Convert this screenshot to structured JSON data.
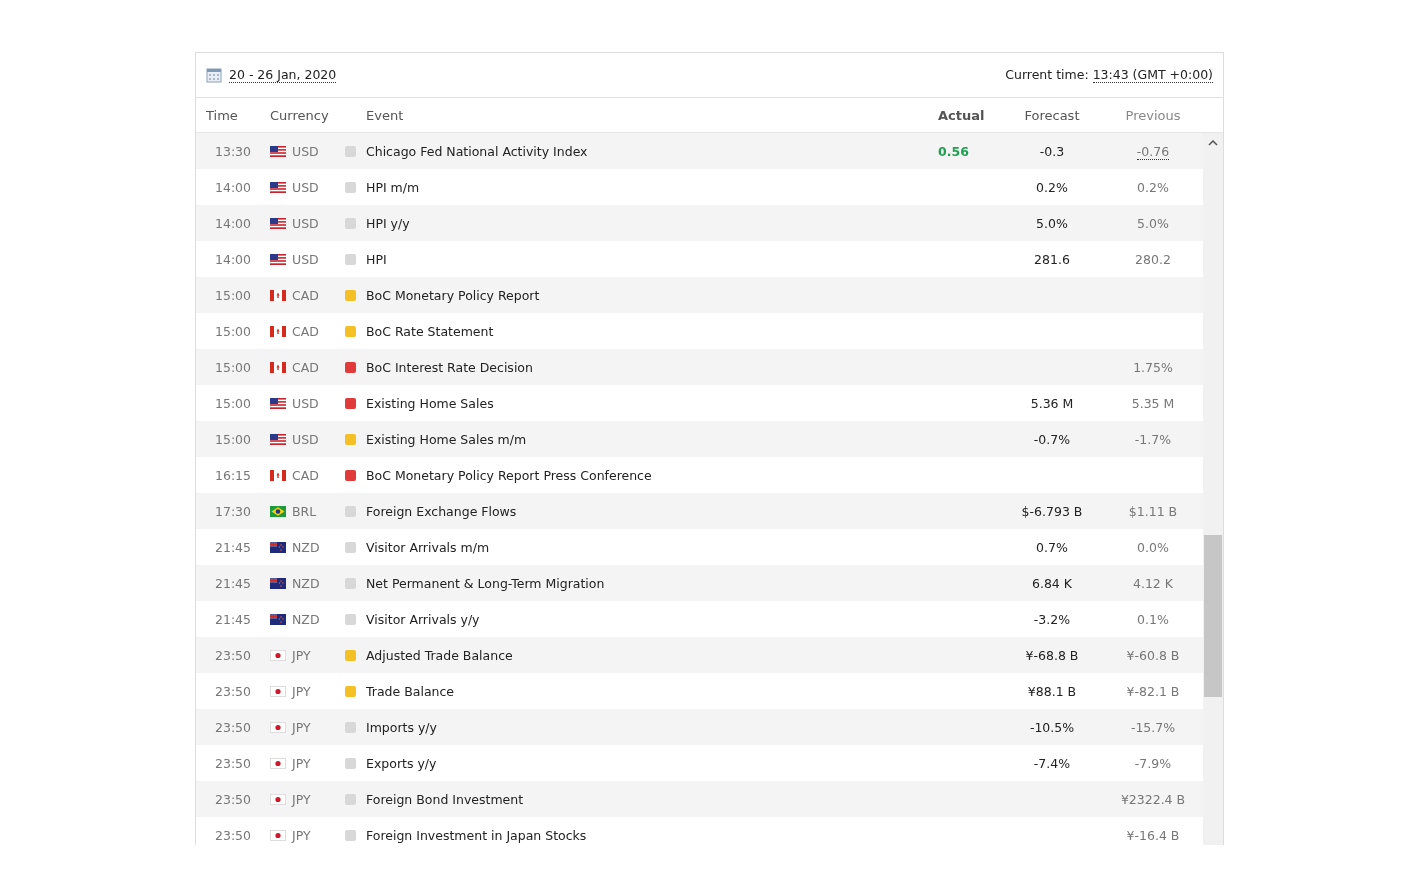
{
  "header": {
    "week": "20 - 26 Jan, 2020",
    "current_time_label": "Current time:",
    "current_time": "13:43 (GMT +0:00)"
  },
  "columns": [
    "Time",
    "Currency",
    "Event",
    "Actual",
    "Forecast",
    "Previous"
  ],
  "rows": [
    {
      "time": "13:30",
      "flag": {
        "kind": "us"
      },
      "currency": "USD",
      "color": "#d8d8d8",
      "event": "Chicago Fed National Activity Index",
      "actual": {
        "text": "0.56",
        "color": "#21a051"
      },
      "forecast": "-0.3",
      "previous": "-0.76",
      "previous_revised": true
    },
    {
      "time": "14:00",
      "flag": {
        "kind": "us"
      },
      "currency": "USD",
      "color": "#d8d8d8",
      "event": "HPI m/m",
      "forecast": "0.2%",
      "previous": "0.2%",
      "previous_revised": false
    },
    {
      "time": "14:00",
      "flag": {
        "kind": "us"
      },
      "currency": "USD",
      "color": "#d8d8d8",
      "event": "HPI y/y",
      "forecast": "5.0%",
      "previous": "5.0%",
      "previous_revised": false
    },
    {
      "time": "14:00",
      "flag": {
        "kind": "us"
      },
      "currency": "USD",
      "color": "#d8d8d8",
      "event": "HPI",
      "forecast": "281.6",
      "previous": "280.2",
      "previous_revised": false
    },
    {
      "time": "15:00",
      "flag": {
        "kind": "ca"
      },
      "currency": "CAD",
      "color": "#f5c026",
      "event": "BoC Monetary Policy Report"
    },
    {
      "time": "15:00",
      "flag": {
        "kind": "ca"
      },
      "currency": "CAD",
      "color": "#f5c026",
      "event": "BoC Rate Statement"
    },
    {
      "time": "15:00",
      "flag": {
        "kind": "ca"
      },
      "currency": "CAD",
      "color": "#e03a3a",
      "event": "BoC Interest Rate Decision",
      "previous": "1.75%",
      "previous_revised": false
    },
    {
      "time": "15:00",
      "flag": {
        "kind": "us"
      },
      "currency": "USD",
      "color": "#e03a3a",
      "event": "Existing Home Sales",
      "forecast": "5.36 M",
      "previous": "5.35 M",
      "previous_revised": false
    },
    {
      "time": "15:00",
      "flag": {
        "kind": "us"
      },
      "currency": "USD",
      "color": "#f5c026",
      "event": "Existing Home Sales m/m",
      "forecast": "-0.7%",
      "previous": "-1.7%",
      "previous_revised": false
    },
    {
      "time": "16:15",
      "flag": {
        "kind": "ca"
      },
      "currency": "CAD",
      "color": "#e03a3a",
      "event": "BoC Monetary Policy Report Press Conference"
    },
    {
      "time": "17:30",
      "flag": {
        "kind": "br"
      },
      "currency": "BRL",
      "color": "#d8d8d8",
      "event": "Foreign Exchange Flows",
      "forecast": "$-6.793 B",
      "previous": "$1.11 B",
      "previous_revised": false
    },
    {
      "time": "21:45",
      "flag": {
        "kind": "nz"
      },
      "currency": "NZD",
      "color": "#d8d8d8",
      "event": "Visitor Arrivals m/m",
      "forecast": "0.7%",
      "previous": "0.0%",
      "previous_revised": false
    },
    {
      "time": "21:45",
      "flag": {
        "kind": "nz"
      },
      "currency": "NZD",
      "color": "#d8d8d8",
      "event": "Net Permanent & Long-Term Migration",
      "forecast": "6.84 K",
      "previous": "4.12 K",
      "previous_revised": false
    },
    {
      "time": "21:45",
      "flag": {
        "kind": "nz"
      },
      "currency": "NZD",
      "color": "#d8d8d8",
      "event": "Visitor Arrivals y/y",
      "forecast": "-3.2%",
      "previous": "0.1%",
      "previous_revised": false
    },
    {
      "time": "23:50",
      "flag": {
        "kind": "jp"
      },
      "currency": "JPY",
      "color": "#f5c026",
      "event": "Adjusted Trade Balance",
      "forecast": "¥-68.8 B",
      "previous": "¥-60.8 B",
      "previous_revised": false
    },
    {
      "time": "23:50",
      "flag": {
        "kind": "jp"
      },
      "currency": "JPY",
      "color": "#f5c026",
      "event": "Trade Balance",
      "forecast": "¥88.1 B",
      "previous": "¥-82.1 B",
      "previous_revised": false
    },
    {
      "time": "23:50",
      "flag": {
        "kind": "jp"
      },
      "currency": "JPY",
      "color": "#d8d8d8",
      "event": "Imports y/y",
      "forecast": "-10.5%",
      "previous": "-15.7%",
      "previous_revised": false
    },
    {
      "time": "23:50",
      "flag": {
        "kind": "jp"
      },
      "currency": "JPY",
      "color": "#d8d8d8",
      "event": "Exports y/y",
      "forecast": "-7.4%",
      "previous": "-7.9%",
      "previous_revised": false
    },
    {
      "time": "23:50",
      "flag": {
        "kind": "jp"
      },
      "currency": "JPY",
      "color": "#d8d8d8",
      "event": "Foreign Bond Investment",
      "previous": "¥2322.4 B",
      "previous_revised": false
    },
    {
      "time": "23:50",
      "flag": {
        "kind": "jp"
      },
      "currency": "JPY",
      "color": "#d8d8d8",
      "event": "Foreign Investment in Japan Stocks",
      "previous": "¥-16.4 B",
      "previous_revised": false
    }
  ]
}
